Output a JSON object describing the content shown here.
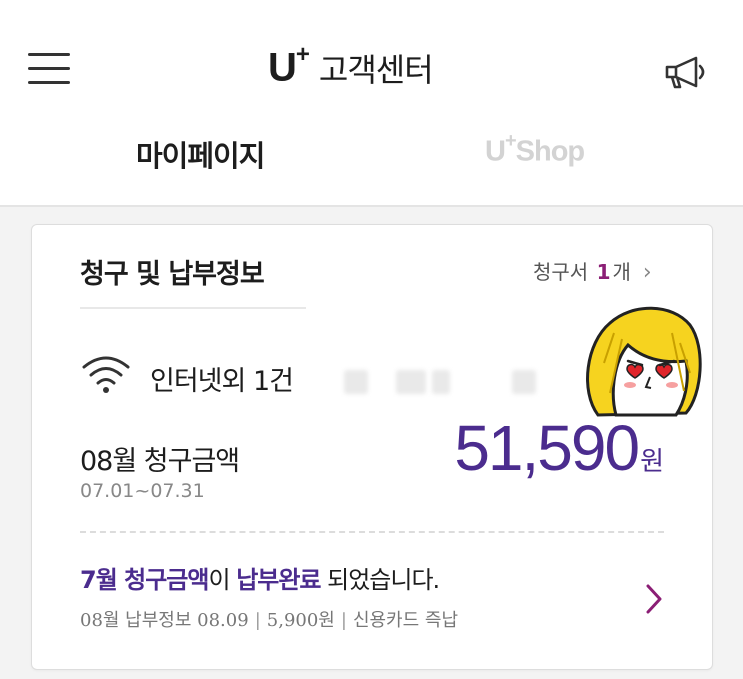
{
  "header": {
    "brand_logo": "U",
    "brand_plus": "+",
    "brand_title": "고객센터",
    "menu_icon": "hamburger-menu-icon",
    "notice_icon": "megaphone-icon"
  },
  "tabs": [
    {
      "label": "마이페이지",
      "active": true
    },
    {
      "label_main": "U",
      "label_plus": "+",
      "label_rest": "Shop",
      "active": false
    }
  ],
  "card": {
    "title": "청구 및 납부정보",
    "bill_link": {
      "prefix": "청구서 ",
      "count": "1",
      "suffix": "개",
      "chevron": "›"
    },
    "service": {
      "icon": "wifi-icon",
      "name": "인터넷외 1건"
    },
    "billing": {
      "month_label": "08월 청구금액",
      "period": "07.01~07.31",
      "amount": "51,590",
      "unit": "원"
    },
    "payment_status": {
      "part1": "7월 청구금액",
      "part2": "이 ",
      "part3": "납부완료",
      "part4": " 되었습니다.",
      "detail_label": "08월 납부정보  08.09",
      "detail_amount": "5,900원",
      "detail_method": "신용카드 즉납",
      "separator": "|"
    }
  },
  "colors": {
    "accent_purple": "#4b2c8e",
    "accent_magenta": "#8b1e75",
    "inactive_tab": "#d3d3d3"
  }
}
